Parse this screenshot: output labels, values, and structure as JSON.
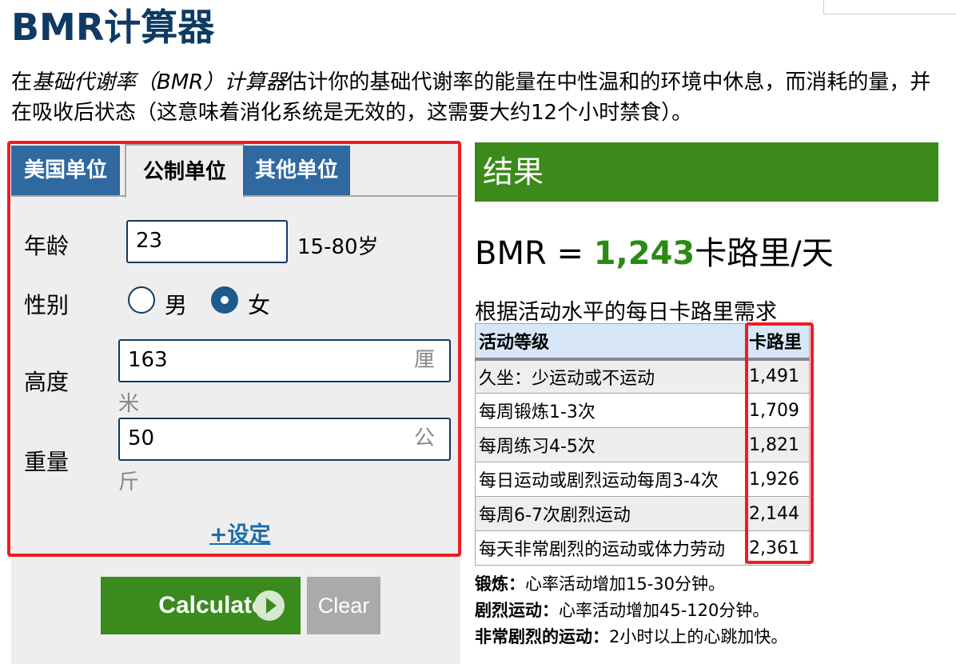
{
  "page": {
    "title": "BMR计算器",
    "intro_prefix": "在",
    "intro_italic": "基础代谢率（BMR）计算器",
    "intro_rest": "估计你的基础代谢率的能量在中性温和的环境中休息，而消耗的量，并在吸收后状态（这意味着消化系统是无效的，这需要大约12个小时禁食）。"
  },
  "tabs": [
    {
      "label": "美国单位",
      "active": false
    },
    {
      "label": "公制单位",
      "active": true
    },
    {
      "label": "其他单位",
      "active": false
    }
  ],
  "form": {
    "age_label": "年龄",
    "age_value": "23",
    "age_hint": "15-80岁",
    "gender_label": "性别",
    "gender_male": "男",
    "gender_female": "女",
    "gender_selected": "female",
    "height_label": "高度",
    "height_value": "163",
    "height_unit_a": "厘",
    "height_unit_b": "米",
    "weight_label": "重量",
    "weight_value": "50",
    "weight_unit_a": "公",
    "weight_unit_b": "斤",
    "settings_link": "+设定"
  },
  "buttons": {
    "calculate": "Calculate",
    "clear": "Clear"
  },
  "results": {
    "header": "结果",
    "bmr_prefix": "BMR = ",
    "bmr_value": "1,243",
    "bmr_unit": "卡路里/天",
    "table_caption": "根据活动水平的每日卡路里需求",
    "col_level": "活动等级",
    "col_calories": "卡路里",
    "rows": [
      {
        "level": "久坐：少运动或不运动",
        "calories": "1,491"
      },
      {
        "level": "每周锻炼1-3次",
        "calories": "1,709"
      },
      {
        "level": "每周练习4-5次",
        "calories": "1,821"
      },
      {
        "level": "每日运动或剧烈运动每周3-4次",
        "calories": "1,926"
      },
      {
        "level": "每周6-7次剧烈运动",
        "calories": "2,144"
      },
      {
        "level": "每天非常剧烈的运动或体力劳动",
        "calories": "2,361"
      }
    ],
    "notes": [
      {
        "term": "锻炼：",
        "text": "心率活动增加15-30分钟。"
      },
      {
        "term": "剧烈运动：",
        "text": "心率活动增加45-120分钟。"
      },
      {
        "term": "非常剧烈的运动：",
        "text": "2小时以上的心跳加快。"
      }
    ]
  },
  "colors": {
    "title": "#0e3a63",
    "tab_blue": "#3068a0",
    "result_green": "#3b8a1a",
    "highlight_red": "#ee1c25"
  },
  "icons": {
    "calculate_button": "play-circle-icon"
  }
}
